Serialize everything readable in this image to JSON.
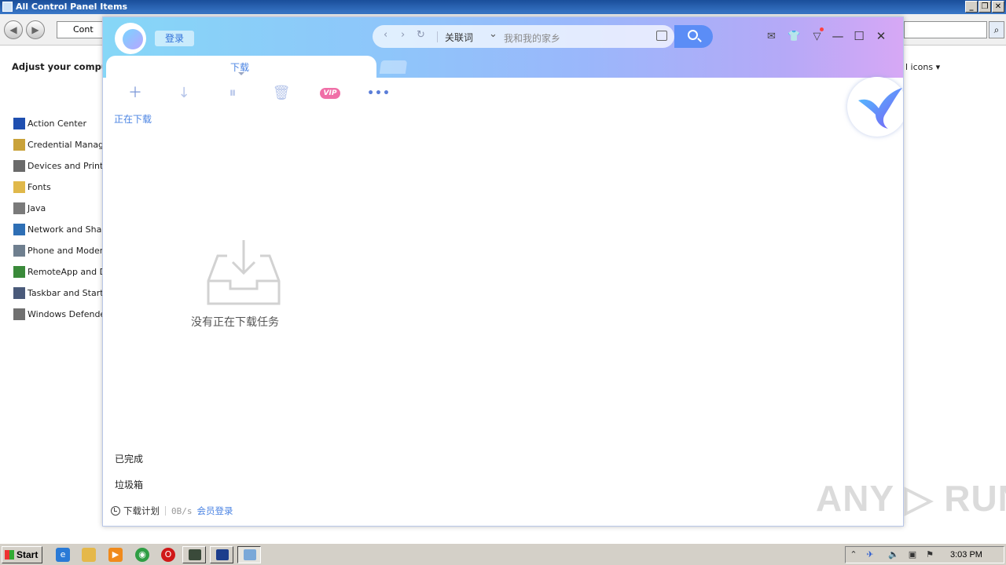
{
  "control_panel": {
    "title": "All Control Panel Items",
    "address_text": "Cont",
    "heading": "Adjust your compute",
    "view_by": "l icons",
    "items": [
      {
        "label": "Action Center",
        "icon": "flag-icon",
        "color": "#1f4fb0"
      },
      {
        "label": "Credential Manager",
        "icon": "vault-icon",
        "color": "#c9a23a"
      },
      {
        "label": "Devices and Printers",
        "icon": "printer-icon",
        "color": "#6a6a6a"
      },
      {
        "label": "Fonts",
        "icon": "fonts-folder-icon",
        "color": "#e0b84a"
      },
      {
        "label": "Java",
        "icon": "java-icon",
        "color": "#7a7a7a"
      },
      {
        "label": "Network and Sharin",
        "icon": "network-icon",
        "color": "#2e6fb5"
      },
      {
        "label": "Phone and Modem",
        "icon": "phone-icon",
        "color": "#6f7f8f"
      },
      {
        "label": "RemoteApp and Des",
        "icon": "remoteapp-icon",
        "color": "#3a8a3a"
      },
      {
        "label": "Taskbar and Start M",
        "icon": "taskbar-icon",
        "color": "#4a5a7a"
      },
      {
        "label": "Windows Defender",
        "icon": "defender-icon",
        "color": "#707070"
      }
    ]
  },
  "app": {
    "login_label": "登录",
    "nav": {
      "keyword_label": "关联词",
      "search_placeholder": "我和我的家乡"
    },
    "tab_label": "下载",
    "toolbar": {
      "vip_label": "VIP"
    },
    "downloading_label": "正在下载",
    "empty_text": "没有正在下载任务",
    "sidebar": {
      "completed": "已完成",
      "trash": "垃圾箱"
    },
    "footer": {
      "plan_label": "下载计划",
      "speed": "0B/s",
      "member_login": "会员登录"
    },
    "colors": {
      "accent": "#4b84e3",
      "vip": "#f06fa7",
      "search_button": "#5b8df6"
    }
  },
  "watermark": "ANY RUN",
  "taskbar": {
    "start_label": "Start",
    "time": "3:03 PM"
  }
}
